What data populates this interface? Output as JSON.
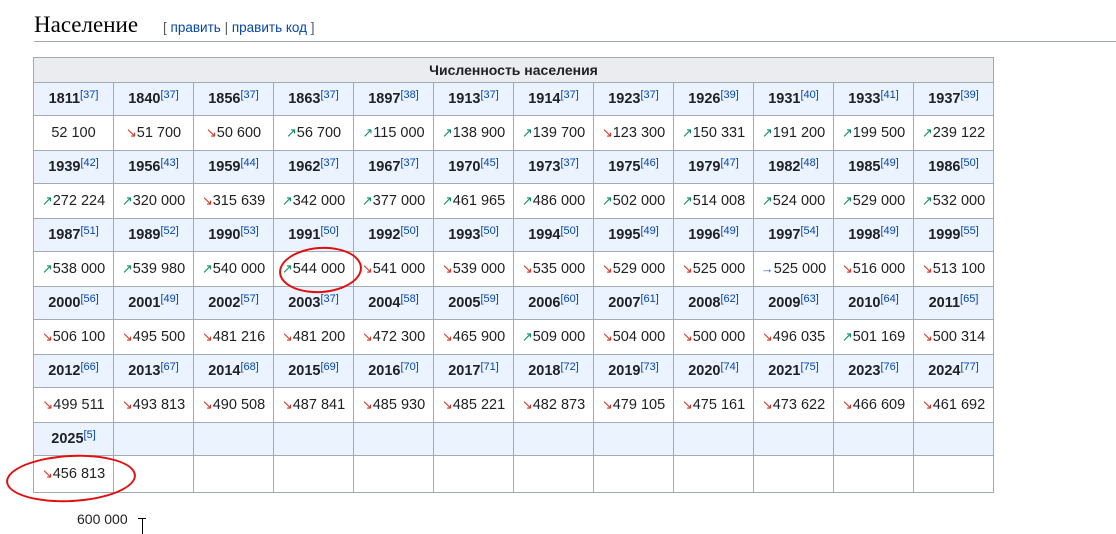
{
  "section": {
    "title": "Население",
    "edit_open": "[",
    "edit_link": "править",
    "separator": "|",
    "edit_code_link": "править код",
    "edit_close": "]"
  },
  "table": {
    "caption": "Численность населения",
    "rows": [
      {
        "years": [
          {
            "year": "1811",
            "ref": "[37]"
          },
          {
            "year": "1840",
            "ref": "[37]"
          },
          {
            "year": "1856",
            "ref": "[37]"
          },
          {
            "year": "1863",
            "ref": "[37]"
          },
          {
            "year": "1897",
            "ref": "[38]"
          },
          {
            "year": "1913",
            "ref": "[37]"
          },
          {
            "year": "1914",
            "ref": "[37]"
          },
          {
            "year": "1923",
            "ref": "[37]"
          },
          {
            "year": "1926",
            "ref": "[39]"
          },
          {
            "year": "1931",
            "ref": "[40]"
          },
          {
            "year": "1933",
            "ref": "[41]"
          },
          {
            "year": "1937",
            "ref": "[39]"
          }
        ],
        "values": [
          {
            "arrow": "",
            "value": "52 100"
          },
          {
            "arrow": "↘",
            "value": "51 700"
          },
          {
            "arrow": "↘",
            "value": "50 600"
          },
          {
            "arrow": "↗",
            "value": "56 700"
          },
          {
            "arrow": "↗",
            "value": "115 000"
          },
          {
            "arrow": "↗",
            "value": "138 900"
          },
          {
            "arrow": "↗",
            "value": "139 700"
          },
          {
            "arrow": "↘",
            "value": "123 300"
          },
          {
            "arrow": "↗",
            "value": "150 331"
          },
          {
            "arrow": "↗",
            "value": "191 200"
          },
          {
            "arrow": "↗",
            "value": "199 500"
          },
          {
            "arrow": "↗",
            "value": "239 122"
          }
        ]
      },
      {
        "years": [
          {
            "year": "1939",
            "ref": "[42]"
          },
          {
            "year": "1956",
            "ref": "[43]"
          },
          {
            "year": "1959",
            "ref": "[44]"
          },
          {
            "year": "1962",
            "ref": "[37]"
          },
          {
            "year": "1967",
            "ref": "[37]"
          },
          {
            "year": "1970",
            "ref": "[45]"
          },
          {
            "year": "1973",
            "ref": "[37]"
          },
          {
            "year": "1975",
            "ref": "[46]"
          },
          {
            "year": "1979",
            "ref": "[47]"
          },
          {
            "year": "1982",
            "ref": "[48]"
          },
          {
            "year": "1985",
            "ref": "[49]"
          },
          {
            "year": "1986",
            "ref": "[50]"
          }
        ],
        "values": [
          {
            "arrow": "↗",
            "value": "272 224"
          },
          {
            "arrow": "↗",
            "value": "320 000"
          },
          {
            "arrow": "↘",
            "value": "315 639"
          },
          {
            "arrow": "↗",
            "value": "342 000"
          },
          {
            "arrow": "↗",
            "value": "377 000"
          },
          {
            "arrow": "↗",
            "value": "461 965"
          },
          {
            "arrow": "↗",
            "value": "486 000"
          },
          {
            "arrow": "↗",
            "value": "502 000"
          },
          {
            "arrow": "↗",
            "value": "514 008"
          },
          {
            "arrow": "↗",
            "value": "524 000"
          },
          {
            "arrow": "↗",
            "value": "529 000"
          },
          {
            "arrow": "↗",
            "value": "532 000"
          }
        ]
      },
      {
        "years": [
          {
            "year": "1987",
            "ref": "[51]"
          },
          {
            "year": "1989",
            "ref": "[52]"
          },
          {
            "year": "1990",
            "ref": "[53]"
          },
          {
            "year": "1991",
            "ref": "[50]"
          },
          {
            "year": "1992",
            "ref": "[50]"
          },
          {
            "year": "1993",
            "ref": "[50]"
          },
          {
            "year": "1994",
            "ref": "[50]"
          },
          {
            "year": "1995",
            "ref": "[49]"
          },
          {
            "year": "1996",
            "ref": "[49]"
          },
          {
            "year": "1997",
            "ref": "[54]"
          },
          {
            "year": "1998",
            "ref": "[49]"
          },
          {
            "year": "1999",
            "ref": "[55]"
          }
        ],
        "values": [
          {
            "arrow": "↗",
            "value": "538 000"
          },
          {
            "arrow": "↗",
            "value": "539 980"
          },
          {
            "arrow": "↗",
            "value": "540 000"
          },
          {
            "arrow": "↗",
            "value": "544 000"
          },
          {
            "arrow": "↘",
            "value": "541 000"
          },
          {
            "arrow": "↘",
            "value": "539 000"
          },
          {
            "arrow": "↘",
            "value": "535 000"
          },
          {
            "arrow": "↘",
            "value": "529 000"
          },
          {
            "arrow": "↘",
            "value": "525 000"
          },
          {
            "arrow": "→",
            "value": "525 000"
          },
          {
            "arrow": "↘",
            "value": "516 000"
          },
          {
            "arrow": "↘",
            "value": "513 100"
          }
        ]
      },
      {
        "years": [
          {
            "year": "2000",
            "ref": "[56]"
          },
          {
            "year": "2001",
            "ref": "[49]"
          },
          {
            "year": "2002",
            "ref": "[57]"
          },
          {
            "year": "2003",
            "ref": "[37]"
          },
          {
            "year": "2004",
            "ref": "[58]"
          },
          {
            "year": "2005",
            "ref": "[59]"
          },
          {
            "year": "2006",
            "ref": "[60]"
          },
          {
            "year": "2007",
            "ref": "[61]"
          },
          {
            "year": "2008",
            "ref": "[62]"
          },
          {
            "year": "2009",
            "ref": "[63]"
          },
          {
            "year": "2010",
            "ref": "[64]"
          },
          {
            "year": "2011",
            "ref": "[65]"
          }
        ],
        "values": [
          {
            "arrow": "↘",
            "value": "506 100"
          },
          {
            "arrow": "↘",
            "value": "495 500"
          },
          {
            "arrow": "↘",
            "value": "481 216"
          },
          {
            "arrow": "↘",
            "value": "481 200"
          },
          {
            "arrow": "↘",
            "value": "472 300"
          },
          {
            "arrow": "↘",
            "value": "465 900"
          },
          {
            "arrow": "↗",
            "value": "509 000"
          },
          {
            "arrow": "↘",
            "value": "504 000"
          },
          {
            "arrow": "↘",
            "value": "500 000"
          },
          {
            "arrow": "↘",
            "value": "496 035"
          },
          {
            "arrow": "↗",
            "value": "501 169"
          },
          {
            "arrow": "↘",
            "value": "500 314"
          }
        ]
      },
      {
        "years": [
          {
            "year": "2012",
            "ref": "[66]"
          },
          {
            "year": "2013",
            "ref": "[67]"
          },
          {
            "year": "2014",
            "ref": "[68]"
          },
          {
            "year": "2015",
            "ref": "[69]"
          },
          {
            "year": "2016",
            "ref": "[70]"
          },
          {
            "year": "2017",
            "ref": "[71]"
          },
          {
            "year": "2018",
            "ref": "[72]"
          },
          {
            "year": "2019",
            "ref": "[73]"
          },
          {
            "year": "2020",
            "ref": "[74]"
          },
          {
            "year": "2021",
            "ref": "[75]"
          },
          {
            "year": "2023",
            "ref": "[76]"
          },
          {
            "year": "2024",
            "ref": "[77]"
          }
        ],
        "values": [
          {
            "arrow": "↘",
            "value": "499 511"
          },
          {
            "arrow": "↘",
            "value": "493 813"
          },
          {
            "arrow": "↘",
            "value": "490 508"
          },
          {
            "arrow": "↘",
            "value": "487 841"
          },
          {
            "arrow": "↘",
            "value": "485 930"
          },
          {
            "arrow": "↘",
            "value": "485 221"
          },
          {
            "arrow": "↘",
            "value": "482 873"
          },
          {
            "arrow": "↘",
            "value": "479 105"
          },
          {
            "arrow": "↘",
            "value": "475 161"
          },
          {
            "arrow": "↘",
            "value": "473 622"
          },
          {
            "arrow": "↘",
            "value": "466 609"
          },
          {
            "arrow": "↘",
            "value": "461 692"
          }
        ]
      },
      {
        "years": [
          {
            "year": "2025",
            "ref": "[5]"
          }
        ],
        "values": [
          {
            "arrow": "↘",
            "value": "456 813"
          }
        ]
      }
    ]
  },
  "chart_axis": {
    "top_label": "600 000"
  },
  "colors": {
    "up": "#088f5f",
    "down": "#dd3322",
    "same": "#3366cc",
    "header_bg": "#eaf3ff",
    "caption_bg": "#eaecf0",
    "link": "#0645ad",
    "annotation": "#e01010"
  }
}
